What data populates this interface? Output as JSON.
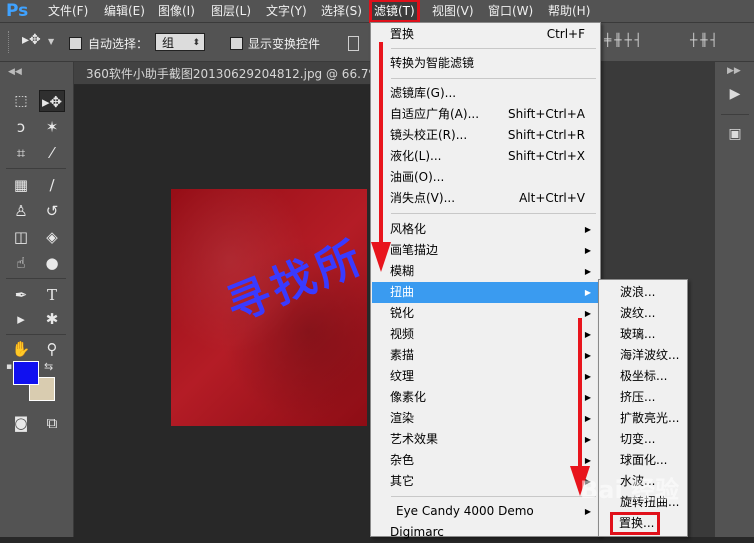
{
  "app": {
    "logo": "Ps"
  },
  "menubar": {
    "items": [
      {
        "label": "文件(F)"
      },
      {
        "label": "编辑(E)"
      },
      {
        "label": "图像(I)"
      },
      {
        "label": "图层(L)"
      },
      {
        "label": "文字(Y)"
      },
      {
        "label": "选择(S)"
      },
      {
        "label": "滤镜(T)"
      },
      {
        "label": "视图(V)"
      },
      {
        "label": "窗口(W)"
      },
      {
        "label": "帮助(H)"
      }
    ]
  },
  "options": {
    "auto_select_label": "自动选择：",
    "auto_select_value": "组",
    "show_transform_label": "显示变换控件"
  },
  "document": {
    "tab_title": "360软件小助手截图20130629204812.jpg @ 66.7% (R",
    "image_text": "寻找所"
  },
  "filter_menu": {
    "items": [
      {
        "label": "置换",
        "shortcut": "Ctrl+F"
      },
      {
        "label": "转换为智能滤镜",
        "shortcut": ""
      },
      {
        "label": "滤镜库(G)...",
        "shortcut": ""
      },
      {
        "label": "自适应广角(A)...",
        "shortcut": "Shift+Ctrl+A"
      },
      {
        "label": "镜头校正(R)...",
        "shortcut": "Shift+Ctrl+R"
      },
      {
        "label": "液化(L)...",
        "shortcut": "Shift+Ctrl+X"
      },
      {
        "label": "油画(O)...",
        "shortcut": ""
      },
      {
        "label": "消失点(V)...",
        "shortcut": "Alt+Ctrl+V"
      },
      {
        "label": "风格化",
        "shortcut": ""
      },
      {
        "label": "画笔描边",
        "shortcut": ""
      },
      {
        "label": "模糊",
        "shortcut": ""
      },
      {
        "label": "扭曲",
        "shortcut": ""
      },
      {
        "label": "锐化",
        "shortcut": ""
      },
      {
        "label": "视频",
        "shortcut": ""
      },
      {
        "label": "素描",
        "shortcut": ""
      },
      {
        "label": "纹理",
        "shortcut": ""
      },
      {
        "label": "像素化",
        "shortcut": ""
      },
      {
        "label": "渲染",
        "shortcut": ""
      },
      {
        "label": "艺术效果",
        "shortcut": ""
      },
      {
        "label": "杂色",
        "shortcut": ""
      },
      {
        "label": "其它",
        "shortcut": ""
      },
      {
        "label": "Eye Candy 4000  Demo",
        "shortcut": ""
      },
      {
        "label": "Digimarc",
        "shortcut": ""
      }
    ]
  },
  "distort_submenu": {
    "items": [
      {
        "label": "波浪..."
      },
      {
        "label": "波纹..."
      },
      {
        "label": "玻璃..."
      },
      {
        "label": "海洋波纹..."
      },
      {
        "label": "极坐标..."
      },
      {
        "label": "挤压..."
      },
      {
        "label": "扩散亮光..."
      },
      {
        "label": "切变..."
      },
      {
        "label": "球面化..."
      },
      {
        "label": "水波..."
      },
      {
        "label": "旋转扭曲..."
      },
      {
        "label": "置换..."
      }
    ]
  },
  "colors": {
    "foreground": "#1010f0",
    "background": "#d9ccb0",
    "highlight": "#3a9bf0",
    "annotation": "#e0101a"
  },
  "watermark": "Bai 经验"
}
